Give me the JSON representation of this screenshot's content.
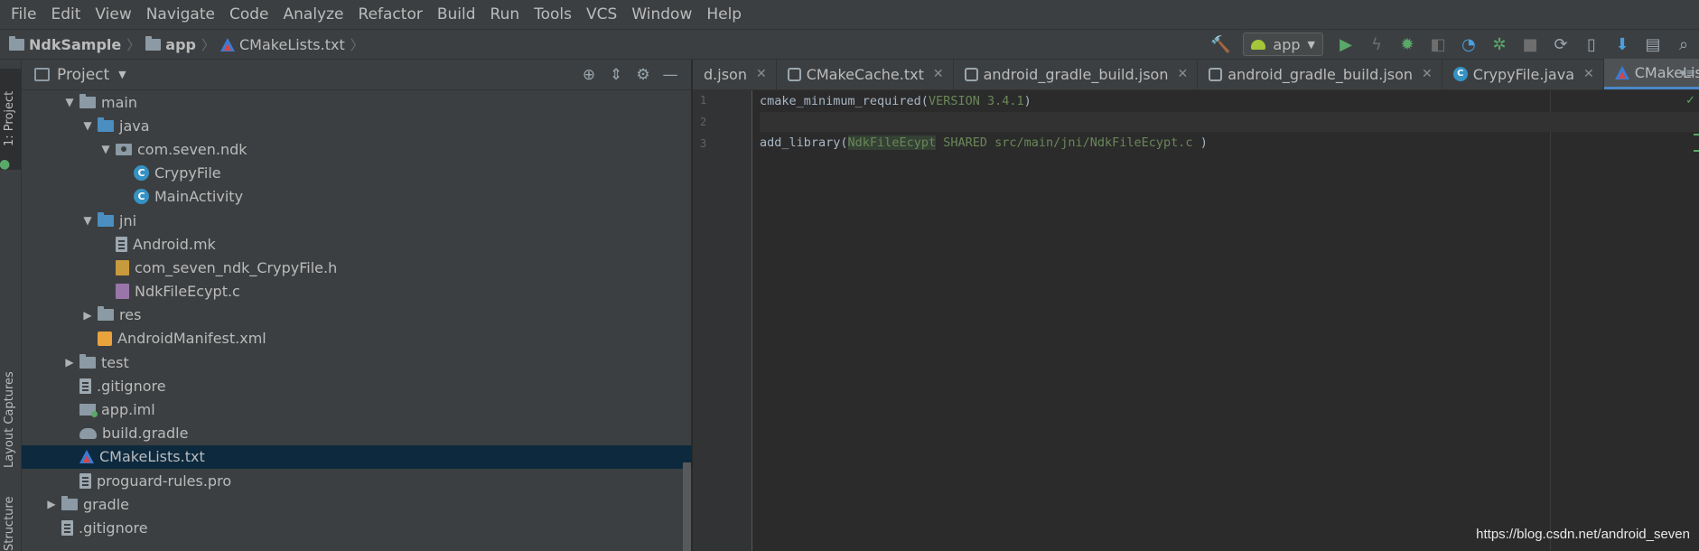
{
  "menu": [
    "File",
    "Edit",
    "View",
    "Navigate",
    "Code",
    "Analyze",
    "Refactor",
    "Build",
    "Run",
    "Tools",
    "VCS",
    "Window",
    "Help"
  ],
  "breadcrumb": {
    "project": "NdkSample",
    "module": "app",
    "file": "CMakeLists.txt"
  },
  "toolbar": {
    "run_config": "app",
    "icons": [
      "hammer-icon",
      "run-icon",
      "lightning-icon",
      "debug-icon",
      "coverage-icon",
      "profiler-icon",
      "attach-debugger-icon",
      "stop-icon",
      "sync-icon",
      "avd-manager-icon",
      "sdk-manager-icon",
      "project-structure-icon",
      "search-icon"
    ]
  },
  "left_strip": {
    "project_tab": "1: Project",
    "captures_tab": "Layout Captures",
    "structure_tab": "Structure"
  },
  "project_panel": {
    "title": "Project",
    "tree": [
      {
        "label": "main",
        "type": "folder",
        "depth": 3,
        "expanded": true
      },
      {
        "label": "java",
        "type": "folder-blue",
        "depth": 4,
        "expanded": true
      },
      {
        "label": "com.seven.ndk",
        "type": "package",
        "depth": 5,
        "expanded": true
      },
      {
        "label": "CrypyFile",
        "type": "class",
        "depth": 6
      },
      {
        "label": "MainActivity",
        "type": "class",
        "depth": 6
      },
      {
        "label": "jni",
        "type": "folder-blue",
        "depth": 4,
        "expanded": true
      },
      {
        "label": "Android.mk",
        "type": "file",
        "depth": 5
      },
      {
        "label": "com_seven_ndk_CrypyFile.h",
        "type": "h",
        "depth": 5
      },
      {
        "label": "NdkFileEcypt.c",
        "type": "c",
        "depth": 5
      },
      {
        "label": "res",
        "type": "folder",
        "depth": 4,
        "expanded": false
      },
      {
        "label": "AndroidManifest.xml",
        "type": "xml",
        "depth": 4
      },
      {
        "label": "test",
        "type": "folder",
        "depth": 3,
        "expanded": false
      },
      {
        "label": ".gitignore",
        "type": "file",
        "depth": 3
      },
      {
        "label": "app.iml",
        "type": "iml",
        "depth": 3
      },
      {
        "label": "build.gradle",
        "type": "gradle",
        "depth": 3
      },
      {
        "label": "CMakeLists.txt",
        "type": "cmake",
        "depth": 3,
        "selected": true
      },
      {
        "label": "proguard-rules.pro",
        "type": "file",
        "depth": 3
      },
      {
        "label": "gradle",
        "type": "folder",
        "depth": 2,
        "expanded": false
      },
      {
        "label": ".gitignore",
        "type": "file",
        "depth": 2
      }
    ]
  },
  "editor": {
    "tabs": [
      {
        "label": "d.json",
        "icon": "none"
      },
      {
        "label": "CMakeCache.txt",
        "icon": "gear"
      },
      {
        "label": "android_gradle_build.json",
        "icon": "gear"
      },
      {
        "label": "android_gradle_build.json",
        "icon": "gear"
      },
      {
        "label": "CrypyFile.java",
        "icon": "class"
      },
      {
        "label": "CMakeLists.txt",
        "icon": "cmake",
        "active": true
      }
    ],
    "line_numbers": [
      "1",
      "2",
      "3"
    ],
    "lines": {
      "l1_fn": "cmake_minimum_required(",
      "l1_arg": "VERSION 3.4.1",
      "l1_end": ")",
      "l3_fn": "add_library(",
      "l3_name": "NdkFileEcypt",
      "l3_args": " SHARED src/main/jni/NdkFileEcypt.c ",
      "l3_end": ")"
    }
  },
  "watermark": "https://blog.csdn.net/android_seven"
}
